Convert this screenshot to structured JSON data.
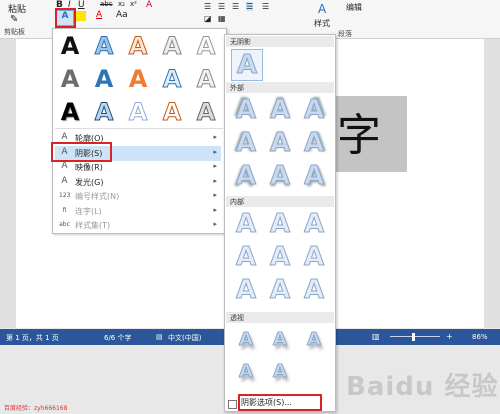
{
  "ribbon": {
    "paste_label": "粘贴",
    "clipboard_group": "剪贴板",
    "bold": "B",
    "italic": "I",
    "underline": "U",
    "strikethrough": "abc",
    "subscript": "x₂",
    "superscript": "x²",
    "font_color": "A",
    "change_case": "Aa",
    "clear_format": "A",
    "paragraph_group": "段落",
    "styles_label": "样式",
    "editing_label": "编辑",
    "text_effects": "A"
  },
  "document": {
    "selected_text": "字"
  },
  "effects_menu": {
    "items": [
      {
        "label": "轮廓(O)",
        "icon": "A",
        "has_submenu": true,
        "disabled": false
      },
      {
        "label": "阴影(S)",
        "icon": "A",
        "has_submenu": true,
        "disabled": false
      },
      {
        "label": "映像(R)",
        "icon": "A",
        "has_submenu": true,
        "disabled": false
      },
      {
        "label": "发光(G)",
        "icon": "A",
        "has_submenu": true,
        "disabled": false
      },
      {
        "label": "编号样式(N)",
        "icon": "123",
        "has_submenu": true,
        "disabled": true
      },
      {
        "label": "连字(L)",
        "icon": "fi",
        "has_submenu": true,
        "disabled": true
      },
      {
        "label": "样式集(T)",
        "icon": "abc",
        "has_submenu": true,
        "disabled": true
      }
    ]
  },
  "shadow_menu": {
    "no_shadow": "无阴影",
    "outer": "外部",
    "inner": "内部",
    "perspective": "透视",
    "options": "阴影选项(S)..."
  },
  "status_bar": {
    "page": "第 1 页，共 1 页",
    "words": "6/6 个字",
    "language": "中文(中国)",
    "zoom": "86%"
  },
  "watermark": {
    "credit": "百度经验：zyh666168",
    "logo": "Baidu 经验"
  },
  "colors": {
    "accent_blue": "#2b579a",
    "highlight_red": "#d9232a",
    "selected_item_bg": "#cde3f7"
  }
}
